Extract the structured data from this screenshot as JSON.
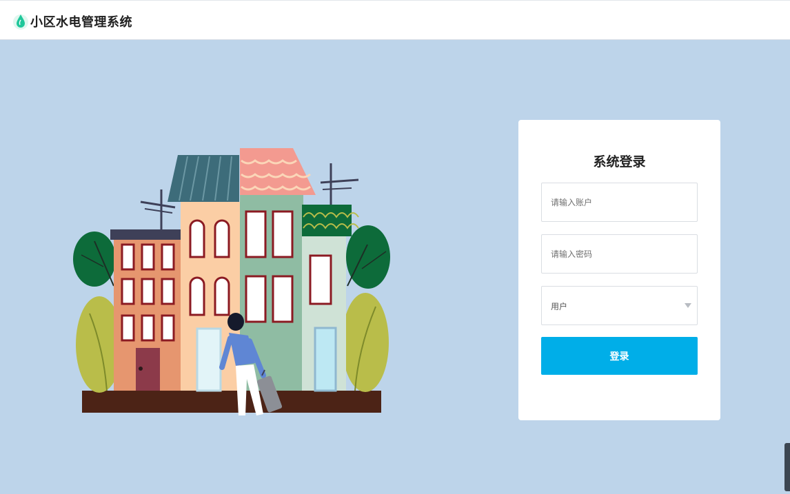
{
  "header": {
    "title": "小区水电管理系统",
    "logo_icon": "water-drop-icon",
    "logo_color": "#1fc79a"
  },
  "login": {
    "title": "系统登录",
    "account_placeholder": "请输入账户",
    "password_placeholder": "请输入密码",
    "role_selected": "用户",
    "submit_label": "登录",
    "accent_color": "#00aee8"
  },
  "background_color": "#bdd4ea"
}
